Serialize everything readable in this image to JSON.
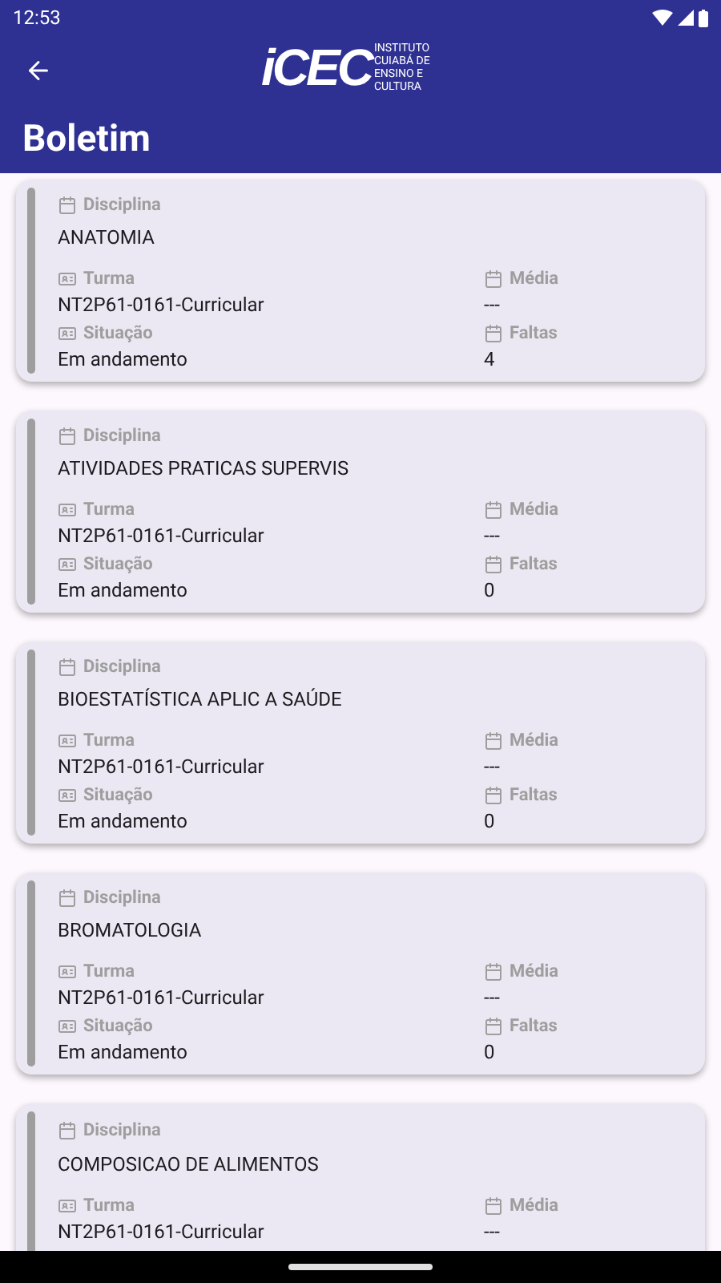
{
  "status_bar": {
    "time": "12:53"
  },
  "app_bar": {
    "logo": {
      "mark": "iCEC",
      "lines": [
        "INSTITUTO",
        "CUIABÁ DE",
        "ENSINO E",
        "CULTURA"
      ]
    },
    "title": "Boletim"
  },
  "cards": [
    {
      "disciplina_label": "Disciplina",
      "disciplina": "ANATOMIA",
      "turma_label": "Turma",
      "turma": "NT2P61-0161-Curricular",
      "media_label": "Média",
      "media": "---",
      "situacao_label": "Situação",
      "situacao": "Em andamento",
      "faltas_label": "Faltas",
      "faltas": "4"
    },
    {
      "disciplina_label": "Disciplina",
      "disciplina": "ATIVIDADES PRATICAS SUPERVIS",
      "turma_label": "Turma",
      "turma": "NT2P61-0161-Curricular",
      "media_label": "Média",
      "media": "---",
      "situacao_label": "Situação",
      "situacao": "Em andamento",
      "faltas_label": "Faltas",
      "faltas": "0"
    },
    {
      "disciplina_label": "Disciplina",
      "disciplina": "BIOESTATÍSTICA APLIC A SAÚDE",
      "turma_label": "Turma",
      "turma": "NT2P61-0161-Curricular",
      "media_label": "Média",
      "media": "---",
      "situacao_label": "Situação",
      "situacao": "Em andamento",
      "faltas_label": "Faltas",
      "faltas": "0"
    },
    {
      "disciplina_label": "Disciplina",
      "disciplina": "BROMATOLOGIA",
      "turma_label": "Turma",
      "turma": "NT2P61-0161-Curricular",
      "media_label": "Média",
      "media": "---",
      "situacao_label": "Situação",
      "situacao": "Em andamento",
      "faltas_label": "Faltas",
      "faltas": "0"
    },
    {
      "disciplina_label": "Disciplina",
      "disciplina": "COMPOSICAO DE ALIMENTOS",
      "turma_label": "Turma",
      "turma": "NT2P61-0161-Curricular",
      "media_label": "Média",
      "media": "---"
    }
  ]
}
